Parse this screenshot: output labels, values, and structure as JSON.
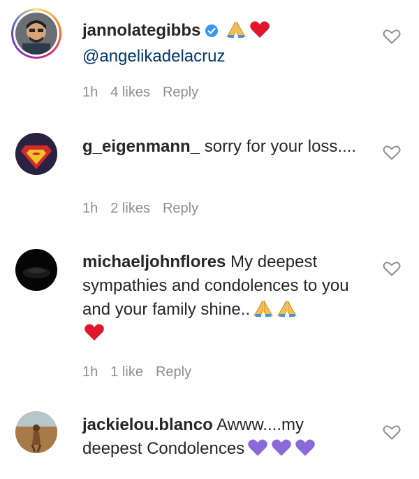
{
  "comments": [
    {
      "username": "jannolategibbs",
      "text": "",
      "mention": "@angelikadelacruz",
      "time": "1h",
      "likes": "4 likes",
      "reply": "Reply",
      "verified": true,
      "emojis": [
        "folded-hands-icon",
        "red-heart-icon"
      ]
    },
    {
      "username": "g_eigenmann_",
      "text": " sorry for your loss....",
      "time": "1h",
      "likes": "2 likes",
      "reply": "Reply"
    },
    {
      "username": "michaeljohnflores",
      "text": " My deepest sympathies and condolences to you and your family shine..",
      "time": "1h",
      "likes": "1 like",
      "reply": "Reply",
      "emojis": [
        "folded-hands-icon",
        "folded-hands-icon",
        "red-heart-icon"
      ]
    },
    {
      "username": "jackielou.blanco",
      "text": " Awww....my deepest Condolences",
      "emojis": [
        "purple-heart-icon",
        "purple-heart-icon",
        "purple-heart-icon"
      ]
    }
  ],
  "colors": {
    "text": "#262626",
    "meta": "#8e8e8e",
    "mention": "#00376b",
    "verified": "#3897f0",
    "heart_red": "#e0172c",
    "heart_purple": "#8a6ad9"
  }
}
